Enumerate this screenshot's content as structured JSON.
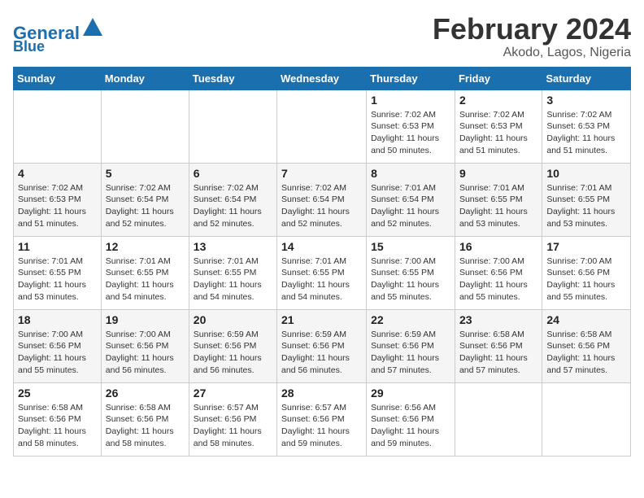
{
  "header": {
    "logo_text_general": "General",
    "logo_text_blue": "Blue",
    "month_year": "February 2024",
    "location": "Akodo, Lagos, Nigeria"
  },
  "weekdays": [
    "Sunday",
    "Monday",
    "Tuesday",
    "Wednesday",
    "Thursday",
    "Friday",
    "Saturday"
  ],
  "weeks": [
    [
      {
        "day": "",
        "sunrise": "",
        "sunset": "",
        "daylight": ""
      },
      {
        "day": "",
        "sunrise": "",
        "sunset": "",
        "daylight": ""
      },
      {
        "day": "",
        "sunrise": "",
        "sunset": "",
        "daylight": ""
      },
      {
        "day": "",
        "sunrise": "",
        "sunset": "",
        "daylight": ""
      },
      {
        "day": "1",
        "sunrise": "Sunrise: 7:02 AM",
        "sunset": "Sunset: 6:53 PM",
        "daylight": "Daylight: 11 hours and 50 minutes."
      },
      {
        "day": "2",
        "sunrise": "Sunrise: 7:02 AM",
        "sunset": "Sunset: 6:53 PM",
        "daylight": "Daylight: 11 hours and 51 minutes."
      },
      {
        "day": "3",
        "sunrise": "Sunrise: 7:02 AM",
        "sunset": "Sunset: 6:53 PM",
        "daylight": "Daylight: 11 hours and 51 minutes."
      }
    ],
    [
      {
        "day": "4",
        "sunrise": "Sunrise: 7:02 AM",
        "sunset": "Sunset: 6:53 PM",
        "daylight": "Daylight: 11 hours and 51 minutes."
      },
      {
        "day": "5",
        "sunrise": "Sunrise: 7:02 AM",
        "sunset": "Sunset: 6:54 PM",
        "daylight": "Daylight: 11 hours and 52 minutes."
      },
      {
        "day": "6",
        "sunrise": "Sunrise: 7:02 AM",
        "sunset": "Sunset: 6:54 PM",
        "daylight": "Daylight: 11 hours and 52 minutes."
      },
      {
        "day": "7",
        "sunrise": "Sunrise: 7:02 AM",
        "sunset": "Sunset: 6:54 PM",
        "daylight": "Daylight: 11 hours and 52 minutes."
      },
      {
        "day": "8",
        "sunrise": "Sunrise: 7:01 AM",
        "sunset": "Sunset: 6:54 PM",
        "daylight": "Daylight: 11 hours and 52 minutes."
      },
      {
        "day": "9",
        "sunrise": "Sunrise: 7:01 AM",
        "sunset": "Sunset: 6:55 PM",
        "daylight": "Daylight: 11 hours and 53 minutes."
      },
      {
        "day": "10",
        "sunrise": "Sunrise: 7:01 AM",
        "sunset": "Sunset: 6:55 PM",
        "daylight": "Daylight: 11 hours and 53 minutes."
      }
    ],
    [
      {
        "day": "11",
        "sunrise": "Sunrise: 7:01 AM",
        "sunset": "Sunset: 6:55 PM",
        "daylight": "Daylight: 11 hours and 53 minutes."
      },
      {
        "day": "12",
        "sunrise": "Sunrise: 7:01 AM",
        "sunset": "Sunset: 6:55 PM",
        "daylight": "Daylight: 11 hours and 54 minutes."
      },
      {
        "day": "13",
        "sunrise": "Sunrise: 7:01 AM",
        "sunset": "Sunset: 6:55 PM",
        "daylight": "Daylight: 11 hours and 54 minutes."
      },
      {
        "day": "14",
        "sunrise": "Sunrise: 7:01 AM",
        "sunset": "Sunset: 6:55 PM",
        "daylight": "Daylight: 11 hours and 54 minutes."
      },
      {
        "day": "15",
        "sunrise": "Sunrise: 7:00 AM",
        "sunset": "Sunset: 6:55 PM",
        "daylight": "Daylight: 11 hours and 55 minutes."
      },
      {
        "day": "16",
        "sunrise": "Sunrise: 7:00 AM",
        "sunset": "Sunset: 6:56 PM",
        "daylight": "Daylight: 11 hours and 55 minutes."
      },
      {
        "day": "17",
        "sunrise": "Sunrise: 7:00 AM",
        "sunset": "Sunset: 6:56 PM",
        "daylight": "Daylight: 11 hours and 55 minutes."
      }
    ],
    [
      {
        "day": "18",
        "sunrise": "Sunrise: 7:00 AM",
        "sunset": "Sunset: 6:56 PM",
        "daylight": "Daylight: 11 hours and 55 minutes."
      },
      {
        "day": "19",
        "sunrise": "Sunrise: 7:00 AM",
        "sunset": "Sunset: 6:56 PM",
        "daylight": "Daylight: 11 hours and 56 minutes."
      },
      {
        "day": "20",
        "sunrise": "Sunrise: 6:59 AM",
        "sunset": "Sunset: 6:56 PM",
        "daylight": "Daylight: 11 hours and 56 minutes."
      },
      {
        "day": "21",
        "sunrise": "Sunrise: 6:59 AM",
        "sunset": "Sunset: 6:56 PM",
        "daylight": "Daylight: 11 hours and 56 minutes."
      },
      {
        "day": "22",
        "sunrise": "Sunrise: 6:59 AM",
        "sunset": "Sunset: 6:56 PM",
        "daylight": "Daylight: 11 hours and 57 minutes."
      },
      {
        "day": "23",
        "sunrise": "Sunrise: 6:58 AM",
        "sunset": "Sunset: 6:56 PM",
        "daylight": "Daylight: 11 hours and 57 minutes."
      },
      {
        "day": "24",
        "sunrise": "Sunrise: 6:58 AM",
        "sunset": "Sunset: 6:56 PM",
        "daylight": "Daylight: 11 hours and 57 minutes."
      }
    ],
    [
      {
        "day": "25",
        "sunrise": "Sunrise: 6:58 AM",
        "sunset": "Sunset: 6:56 PM",
        "daylight": "Daylight: 11 hours and 58 minutes."
      },
      {
        "day": "26",
        "sunrise": "Sunrise: 6:58 AM",
        "sunset": "Sunset: 6:56 PM",
        "daylight": "Daylight: 11 hours and 58 minutes."
      },
      {
        "day": "27",
        "sunrise": "Sunrise: 6:57 AM",
        "sunset": "Sunset: 6:56 PM",
        "daylight": "Daylight: 11 hours and 58 minutes."
      },
      {
        "day": "28",
        "sunrise": "Sunrise: 6:57 AM",
        "sunset": "Sunset: 6:56 PM",
        "daylight": "Daylight: 11 hours and 59 minutes."
      },
      {
        "day": "29",
        "sunrise": "Sunrise: 6:56 AM",
        "sunset": "Sunset: 6:56 PM",
        "daylight": "Daylight: 11 hours and 59 minutes."
      },
      {
        "day": "",
        "sunrise": "",
        "sunset": "",
        "daylight": ""
      },
      {
        "day": "",
        "sunrise": "",
        "sunset": "",
        "daylight": ""
      }
    ]
  ]
}
